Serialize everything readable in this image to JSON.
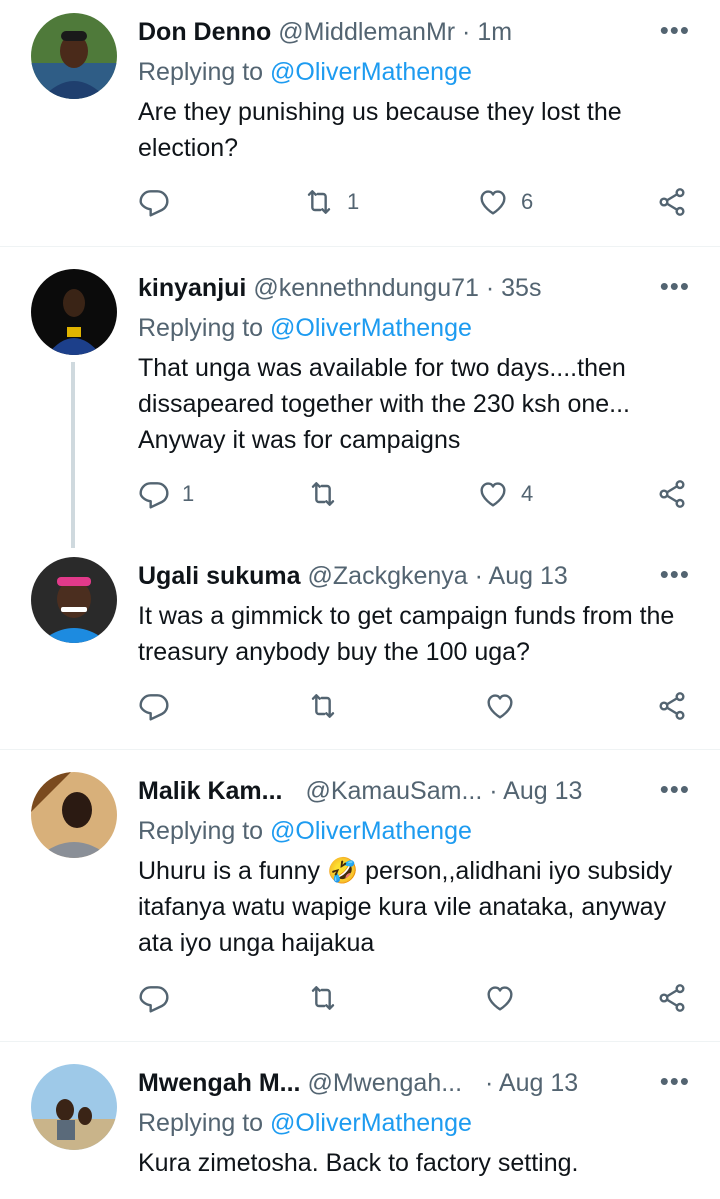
{
  "tweets": [
    {
      "name": "Don Denno",
      "handle": "@MiddlemanMr",
      "time": "· 1m",
      "replying_label": "Replying to",
      "replying_to": "@OliverMathenge",
      "text": "Are they punishing us because they lost the election?",
      "reply_count": "",
      "retweet_count": "1",
      "like_count": "6"
    },
    {
      "name": "kinyanjui",
      "handle": "@kennethndungu71",
      "time": "· 35s",
      "replying_label": "Replying to",
      "replying_to": "@OliverMathenge",
      "text": "That unga was available for two days....then dissapeared together with the 230 ksh one... Anyway it was for campaigns",
      "reply_count": "1",
      "retweet_count": "",
      "like_count": "4"
    },
    {
      "name": "Ugali sukuma",
      "handle": "@Zackgkenya",
      "time": "· Aug 13",
      "text": "It was a gimmick to get campaign funds from the treasury anybody buy the 100 uga?",
      "reply_count": "",
      "retweet_count": "",
      "like_count": ""
    },
    {
      "name": "Malik Kam...",
      "handle": "@KamauSam...",
      "time": "· Aug 13",
      "replying_label": "Replying to",
      "replying_to": "@OliverMathenge",
      "text_before_emoji": "Uhuru is a funny",
      "emoji": "🤣",
      "text_after_emoji": "person,,alidhani iyo subsidy itafanya watu wapige kura vile anataka, anyway ata iyo unga haijakua",
      "reply_count": "",
      "retweet_count": "",
      "like_count": ""
    },
    {
      "name": "Mwengah M...",
      "handle": "@Mwengah...",
      "time": "· Aug 13",
      "replying_label": "Replying to",
      "replying_to": "@OliverMathenge",
      "text": "Kura zimetosha. Back to factory setting."
    }
  ],
  "more_glyph": "•••",
  "icons": [
    "reply-icon",
    "retweet-icon",
    "like-icon",
    "share-icon",
    "more-icon",
    "emoji-rofl"
  ],
  "colors": {
    "link": "#1d9bf0",
    "muted": "#536471",
    "text": "#0f1419",
    "divider": "#eff3f4"
  }
}
